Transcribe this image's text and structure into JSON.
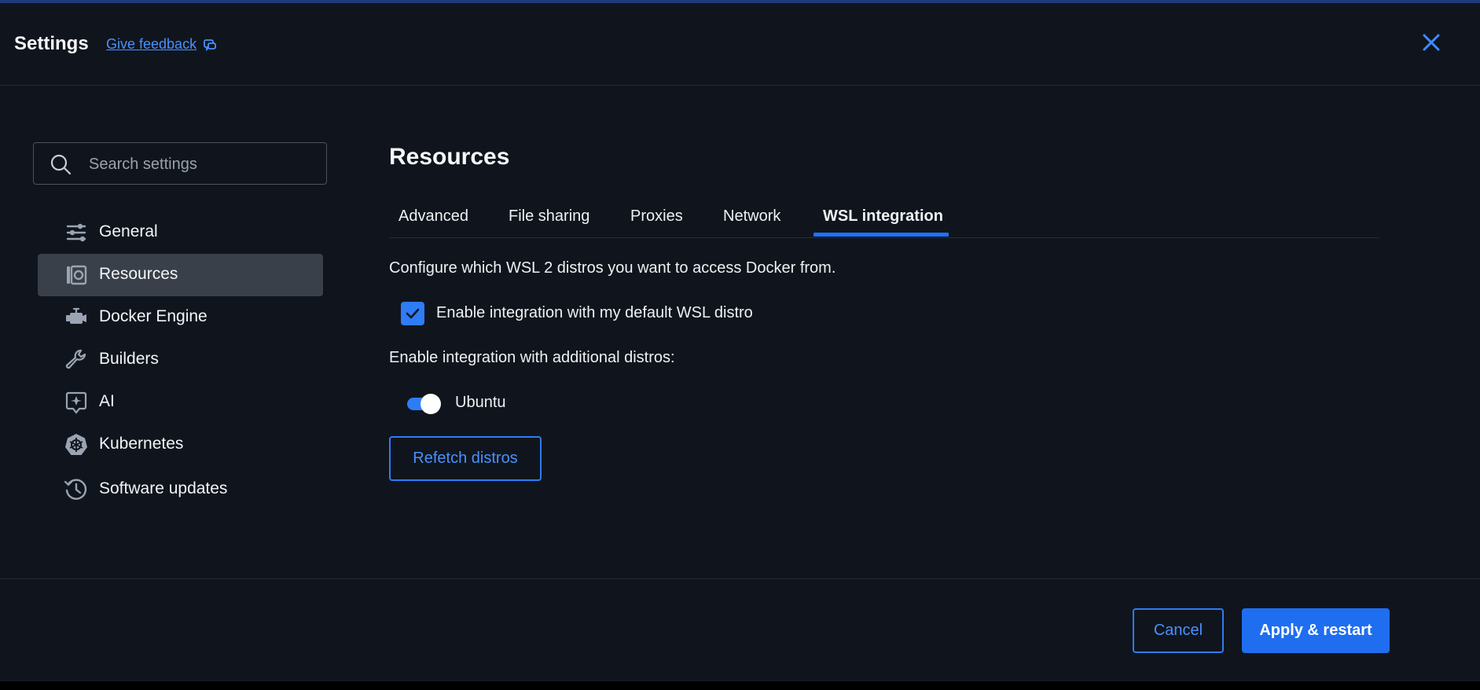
{
  "header": {
    "title": "Settings",
    "feedback_label": "Give feedback",
    "feedback_icon": "feedback-icon",
    "close_icon": "close-icon"
  },
  "sidebar": {
    "search_placeholder": "Search settings",
    "search_value": "",
    "items": [
      {
        "label": "General",
        "icon": "sliders-icon",
        "active": false
      },
      {
        "label": "Resources",
        "icon": "resources-icon",
        "active": true
      },
      {
        "label": "Docker Engine",
        "icon": "engine-icon",
        "active": false
      },
      {
        "label": "Builders",
        "icon": "wrench-icon",
        "active": false
      },
      {
        "label": "AI",
        "icon": "ai-sparkle-icon",
        "active": false
      },
      {
        "label": "Kubernetes",
        "icon": "kubernetes-icon",
        "active": false
      },
      {
        "label": "Software updates",
        "icon": "history-icon",
        "active": false
      }
    ]
  },
  "main": {
    "title": "Resources",
    "tabs": [
      {
        "label": "Advanced",
        "active": false
      },
      {
        "label": "File sharing",
        "active": false
      },
      {
        "label": "Proxies",
        "active": false
      },
      {
        "label": "Network",
        "active": false
      },
      {
        "label": "WSL integration",
        "active": true
      }
    ],
    "description": "Configure which WSL 2 distros you want to access Docker from.",
    "default_distro": {
      "label": "Enable integration with my default WSL distro",
      "checked": true
    },
    "additional_heading": "Enable integration with additional distros:",
    "distros": [
      {
        "label": "Ubuntu",
        "enabled": true
      }
    ],
    "refetch_label": "Refetch distros"
  },
  "footer": {
    "cancel_label": "Cancel",
    "apply_label": "Apply & restart"
  },
  "colors": {
    "background": "#10151d",
    "accent": "#2e7cf6",
    "active_nav": "#3a4049",
    "link": "#4a90ff"
  }
}
